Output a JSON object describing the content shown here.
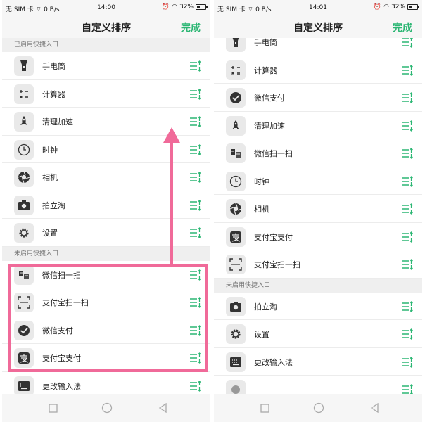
{
  "accent_color": "#2bb673",
  "highlight_color": "#f06a99",
  "left": {
    "status": {
      "carrier": "无 SIM 卡",
      "speed": "0 B/s",
      "time": "14:00",
      "battery": "32%"
    },
    "title": "自定义排序",
    "done": "完成",
    "sections": [
      {
        "header": "已启用快捷入口",
        "items": [
          {
            "label": "手电筒",
            "icon": "flashlight-icon"
          },
          {
            "label": "计算器",
            "icon": "calculator-icon"
          },
          {
            "label": "清理加速",
            "icon": "rocket-icon"
          },
          {
            "label": "时钟",
            "icon": "clock-icon"
          },
          {
            "label": "相机",
            "icon": "camera-shutter-icon"
          },
          {
            "label": "拍立淘",
            "icon": "photo-camera-icon"
          },
          {
            "label": "设置",
            "icon": "gear-icon"
          }
        ]
      },
      {
        "header": "未启用快捷入口",
        "items": [
          {
            "label": "微信扫一扫",
            "icon": "wechat-scan-icon"
          },
          {
            "label": "支付宝扫一扫",
            "icon": "scan-frame-icon"
          },
          {
            "label": "微信支付",
            "icon": "wechat-pay-icon"
          },
          {
            "label": "支付宝支付",
            "icon": "alipay-icon"
          },
          {
            "label": "更改输入法",
            "icon": "keyboard-icon"
          }
        ]
      }
    ]
  },
  "right": {
    "status": {
      "carrier": "无 SIM 卡",
      "speed": "0 B/s",
      "time": "14:01",
      "battery": "32%"
    },
    "title": "自定义排序",
    "done": "完成",
    "sections": [
      {
        "header": "",
        "items": [
          {
            "label": "手电筒",
            "icon": "flashlight-icon"
          },
          {
            "label": "计算器",
            "icon": "calculator-icon"
          },
          {
            "label": "微信支付",
            "icon": "wechat-pay-icon"
          },
          {
            "label": "清理加速",
            "icon": "rocket-icon"
          },
          {
            "label": "微信扫一扫",
            "icon": "wechat-scan-icon"
          },
          {
            "label": "时钟",
            "icon": "clock-icon"
          },
          {
            "label": "相机",
            "icon": "camera-shutter-icon"
          },
          {
            "label": "支付宝支付",
            "icon": "alipay-icon"
          },
          {
            "label": "支付宝扫一扫",
            "icon": "scan-frame-icon"
          }
        ]
      },
      {
        "header": "未启用快捷入口",
        "items": [
          {
            "label": "拍立淘",
            "icon": "photo-camera-icon"
          },
          {
            "label": "设置",
            "icon": "gear-icon"
          },
          {
            "label": "更改输入法",
            "icon": "keyboard-icon"
          },
          {
            "label": "",
            "icon": "partial-icon"
          }
        ]
      }
    ]
  }
}
